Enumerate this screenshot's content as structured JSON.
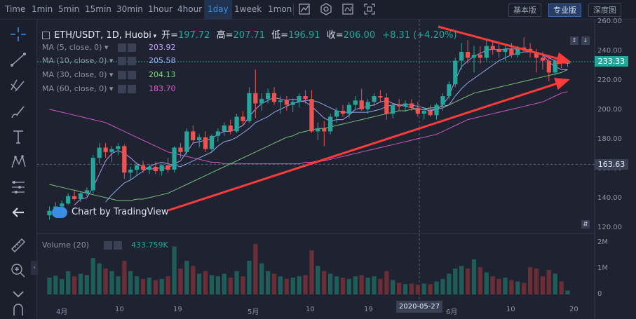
{
  "toolbar": {
    "timeframes": [
      "Time",
      "1min",
      "5min",
      "15min",
      "30min",
      "1hour",
      "4hour",
      "1day",
      "1week",
      "1mon"
    ],
    "active_timeframe": "1day",
    "modes": [
      "基本版",
      "专业版",
      "深度图"
    ],
    "active_mode": "专业版"
  },
  "legend": {
    "symbol": "ETH/USDT, 1D, Huobi",
    "open_label": "开=",
    "open": "197.72",
    "high_label": "高=",
    "high": "207.71",
    "low_label": "低=",
    "low": "196.91",
    "close_label": "收=",
    "close": "206.00",
    "change": "+8.31 (+4.20%)"
  },
  "ma_lines": [
    {
      "label": "MA (5, close, 0)",
      "value": "203.92",
      "color": "#c8a2ff"
    },
    {
      "label": "MA (10, close, 0)",
      "value": "205.58",
      "color": "#a0b4ff"
    },
    {
      "label": "MA (30, close, 0)",
      "value": "204.13",
      "color": "#7fd47f"
    },
    {
      "label": "MA (60, close, 0)",
      "value": "183.70",
      "color": "#e05fd0"
    }
  ],
  "volume_legend": {
    "label": "Volume (20)",
    "value": "433.759K"
  },
  "price_axis": {
    "ticks": [
      "260.00",
      "240.00",
      "220.00",
      "200.00",
      "180.00",
      "160.00",
      "140.00",
      "120.00"
    ]
  },
  "volume_axis": {
    "ticks": [
      "2M",
      "1M",
      "0"
    ]
  },
  "time_axis": {
    "ticks": [
      "4月",
      "10",
      "19",
      "5月",
      "10",
      "19",
      "6月",
      "10",
      "20"
    ],
    "crosshair_date": "2020-05-27"
  },
  "current_price": "233.33",
  "crosshair_price": "163.63",
  "watermark": "Chart by TradingView",
  "colors": {
    "up": "#26a69a",
    "down": "#ef5350",
    "background": "#1f2331",
    "accent": "#3a8ee6",
    "arrow": "#ff3b3b"
  },
  "chart_data": {
    "type": "candlestick",
    "price_range": [
      120,
      260
    ],
    "volume_range": [
      0,
      2000000
    ],
    "x_axis_ticks": [
      "4月",
      "10",
      "19",
      "5月",
      "10",
      "19",
      "6月",
      "10",
      "20"
    ],
    "candles": [
      {
        "o": 129,
        "h": 135,
        "l": 126,
        "c": 132,
        "v": 650000
      },
      {
        "o": 132,
        "h": 138,
        "l": 128,
        "c": 135,
        "v": 720000
      },
      {
        "o": 135,
        "h": 139,
        "l": 133,
        "c": 137,
        "v": 600000
      },
      {
        "o": 137,
        "h": 144,
        "l": 136,
        "c": 142,
        "v": 900000
      },
      {
        "o": 142,
        "h": 146,
        "l": 139,
        "c": 140,
        "v": 700000
      },
      {
        "o": 140,
        "h": 145,
        "l": 138,
        "c": 144,
        "v": 800000
      },
      {
        "o": 144,
        "h": 148,
        "l": 142,
        "c": 146,
        "v": 750000
      },
      {
        "o": 146,
        "h": 170,
        "l": 144,
        "c": 168,
        "v": 1400000
      },
      {
        "o": 168,
        "h": 178,
        "l": 164,
        "c": 175,
        "v": 1200000
      },
      {
        "o": 175,
        "h": 178,
        "l": 168,
        "c": 172,
        "v": 1000000
      },
      {
        "o": 172,
        "h": 176,
        "l": 165,
        "c": 174,
        "v": 900000
      },
      {
        "o": 174,
        "h": 178,
        "l": 170,
        "c": 176,
        "v": 700000
      },
      {
        "o": 176,
        "h": 177,
        "l": 154,
        "c": 158,
        "v": 1300000
      },
      {
        "o": 158,
        "h": 162,
        "l": 153,
        "c": 160,
        "v": 900000
      },
      {
        "o": 160,
        "h": 165,
        "l": 156,
        "c": 163,
        "v": 700000
      },
      {
        "o": 163,
        "h": 166,
        "l": 158,
        "c": 160,
        "v": 600000
      },
      {
        "o": 160,
        "h": 164,
        "l": 157,
        "c": 162,
        "v": 650000
      },
      {
        "o": 162,
        "h": 165,
        "l": 157,
        "c": 159,
        "v": 550000
      },
      {
        "o": 159,
        "h": 164,
        "l": 156,
        "c": 163,
        "v": 600000
      },
      {
        "o": 163,
        "h": 168,
        "l": 158,
        "c": 160,
        "v": 700000
      },
      {
        "o": 160,
        "h": 176,
        "l": 158,
        "c": 175,
        "v": 1850000
      },
      {
        "o": 175,
        "h": 178,
        "l": 168,
        "c": 172,
        "v": 1000000
      },
      {
        "o": 172,
        "h": 188,
        "l": 170,
        "c": 186,
        "v": 1300000
      },
      {
        "o": 186,
        "h": 190,
        "l": 178,
        "c": 180,
        "v": 1100000
      },
      {
        "o": 180,
        "h": 184,
        "l": 175,
        "c": 182,
        "v": 800000
      },
      {
        "o": 182,
        "h": 186,
        "l": 172,
        "c": 174,
        "v": 900000
      },
      {
        "o": 174,
        "h": 184,
        "l": 172,
        "c": 183,
        "v": 750000
      },
      {
        "o": 183,
        "h": 188,
        "l": 179,
        "c": 186,
        "v": 700000
      },
      {
        "o": 186,
        "h": 192,
        "l": 183,
        "c": 190,
        "v": 800000
      },
      {
        "o": 190,
        "h": 194,
        "l": 184,
        "c": 186,
        "v": 650000
      },
      {
        "o": 186,
        "h": 198,
        "l": 185,
        "c": 196,
        "v": 900000
      },
      {
        "o": 196,
        "h": 200,
        "l": 190,
        "c": 193,
        "v": 700000
      },
      {
        "o": 193,
        "h": 216,
        "l": 192,
        "c": 212,
        "v": 1300000
      },
      {
        "o": 212,
        "h": 228,
        "l": 195,
        "c": 205,
        "v": 1950000
      },
      {
        "o": 205,
        "h": 212,
        "l": 200,
        "c": 208,
        "v": 1200000
      },
      {
        "o": 208,
        "h": 215,
        "l": 205,
        "c": 212,
        "v": 900000
      },
      {
        "o": 212,
        "h": 216,
        "l": 204,
        "c": 206,
        "v": 800000
      },
      {
        "o": 206,
        "h": 210,
        "l": 198,
        "c": 207,
        "v": 700000
      },
      {
        "o": 207,
        "h": 210,
        "l": 200,
        "c": 204,
        "v": 600000
      },
      {
        "o": 204,
        "h": 208,
        "l": 199,
        "c": 206,
        "v": 650000
      },
      {
        "o": 206,
        "h": 212,
        "l": 202,
        "c": 210,
        "v": 700000
      },
      {
        "o": 210,
        "h": 214,
        "l": 205,
        "c": 208,
        "v": 750000
      },
      {
        "o": 208,
        "h": 214,
        "l": 185,
        "c": 186,
        "v": 1700000
      },
      {
        "o": 186,
        "h": 192,
        "l": 180,
        "c": 188,
        "v": 1100000
      },
      {
        "o": 188,
        "h": 193,
        "l": 176,
        "c": 186,
        "v": 900000
      },
      {
        "o": 186,
        "h": 198,
        "l": 184,
        "c": 196,
        "v": 800000
      },
      {
        "o": 196,
        "h": 202,
        "l": 192,
        "c": 200,
        "v": 700000
      },
      {
        "o": 200,
        "h": 204,
        "l": 196,
        "c": 198,
        "v": 650000
      },
      {
        "o": 198,
        "h": 206,
        "l": 195,
        "c": 204,
        "v": 600000
      },
      {
        "o": 204,
        "h": 210,
        "l": 201,
        "c": 207,
        "v": 700000
      },
      {
        "o": 207,
        "h": 215,
        "l": 200,
        "c": 201,
        "v": 750000
      },
      {
        "o": 201,
        "h": 208,
        "l": 198,
        "c": 206,
        "v": 650000
      },
      {
        "o": 206,
        "h": 212,
        "l": 203,
        "c": 210,
        "v": 700000
      },
      {
        "o": 210,
        "h": 214,
        "l": 206,
        "c": 209,
        "v": 600000
      },
      {
        "o": 209,
        "h": 212,
        "l": 194,
        "c": 198,
        "v": 900000
      },
      {
        "o": 198,
        "h": 205,
        "l": 195,
        "c": 204,
        "v": 550000
      },
      {
        "o": 204,
        "h": 208,
        "l": 200,
        "c": 203,
        "v": 450000
      },
      {
        "o": 203,
        "h": 207,
        "l": 199,
        "c": 205,
        "v": 400000
      },
      {
        "o": 205,
        "h": 208,
        "l": 200,
        "c": 202,
        "v": 420000
      },
      {
        "o": 202,
        "h": 206,
        "l": 196,
        "c": 198,
        "v": 380000
      },
      {
        "o": 198,
        "h": 202,
        "l": 194,
        "c": 200,
        "v": 420000
      },
      {
        "o": 200,
        "h": 204,
        "l": 196,
        "c": 197,
        "v": 400000
      },
      {
        "o": 197,
        "h": 205,
        "l": 194,
        "c": 204,
        "v": 500000
      },
      {
        "o": 204,
        "h": 212,
        "l": 200,
        "c": 210,
        "v": 600000
      },
      {
        "o": 210,
        "h": 220,
        "l": 208,
        "c": 218,
        "v": 800000
      },
      {
        "o": 218,
        "h": 236,
        "l": 216,
        "c": 234,
        "v": 1000000
      },
      {
        "o": 234,
        "h": 246,
        "l": 228,
        "c": 240,
        "v": 1100000
      },
      {
        "o": 240,
        "h": 248,
        "l": 232,
        "c": 236,
        "v": 1000000
      },
      {
        "o": 236,
        "h": 244,
        "l": 226,
        "c": 238,
        "v": 1350000
      },
      {
        "o": 238,
        "h": 244,
        "l": 232,
        "c": 236,
        "v": 1050000
      },
      {
        "o": 236,
        "h": 248,
        "l": 234,
        "c": 244,
        "v": 850000
      },
      {
        "o": 244,
        "h": 248,
        "l": 238,
        "c": 242,
        "v": 700000
      },
      {
        "o": 242,
        "h": 246,
        "l": 236,
        "c": 240,
        "v": 600000
      },
      {
        "o": 240,
        "h": 244,
        "l": 234,
        "c": 242,
        "v": 650000
      },
      {
        "o": 242,
        "h": 246,
        "l": 236,
        "c": 238,
        "v": 550000
      },
      {
        "o": 238,
        "h": 244,
        "l": 236,
        "c": 243,
        "v": 500000
      },
      {
        "o": 243,
        "h": 250,
        "l": 240,
        "c": 242,
        "v": 450000
      },
      {
        "o": 242,
        "h": 246,
        "l": 236,
        "c": 240,
        "v": 1050000
      },
      {
        "o": 240,
        "h": 242,
        "l": 226,
        "c": 236,
        "v": 1000000
      },
      {
        "o": 236,
        "h": 240,
        "l": 228,
        "c": 234,
        "v": 700000
      },
      {
        "o": 234,
        "h": 238,
        "l": 220,
        "c": 226,
        "v": 950000
      },
      {
        "o": 226,
        "h": 236,
        "l": 224,
        "c": 234,
        "v": 800000
      },
      {
        "o": 234,
        "h": 236,
        "l": 229,
        "c": 232,
        "v": 500000
      },
      {
        "o": 232,
        "h": 235,
        "l": 230,
        "c": 233.33,
        "v": 150000
      }
    ],
    "ma5": [
      null,
      null,
      null,
      null,
      136,
      140,
      141,
      148,
      157,
      166,
      171,
      173,
      171,
      168,
      164,
      162,
      160,
      161,
      161,
      161,
      164,
      166,
      172,
      178,
      179,
      180,
      181,
      184,
      186,
      186,
      188,
      190,
      196,
      201,
      205,
      207,
      209,
      208,
      207,
      208,
      207,
      206,
      203,
      199,
      195,
      193,
      194,
      194,
      197,
      201,
      202,
      203,
      204,
      206,
      207,
      205,
      204,
      203,
      202,
      201,
      201,
      200,
      201,
      204,
      210,
      221,
      230,
      234,
      237,
      239,
      241,
      242,
      241,
      242,
      242,
      242,
      242,
      241,
      239,
      238,
      233,
      230,
      228,
      228
    ],
    "ma10": [
      null,
      null,
      null,
      null,
      null,
      null,
      null,
      null,
      null,
      138,
      143,
      147,
      151,
      153,
      156,
      159,
      162,
      164,
      165,
      164,
      163,
      162,
      164,
      166,
      168,
      170,
      172,
      176,
      179,
      180,
      182,
      185,
      188,
      192,
      194,
      196,
      199,
      201,
      203,
      205,
      206,
      207,
      207,
      206,
      204,
      202,
      200,
      199,
      199,
      199,
      199,
      199,
      200,
      201,
      203,
      204,
      204,
      204,
      204,
      203,
      202,
      201,
      201,
      202,
      204,
      210,
      215,
      219,
      222,
      225,
      228,
      231,
      234,
      236,
      238,
      239,
      240,
      240,
      239,
      238,
      236,
      234,
      233,
      232
    ],
    "ma30": [
      150,
      149,
      148,
      147,
      146,
      145,
      144,
      143,
      142,
      141,
      140,
      139,
      139,
      139,
      140,
      140,
      141,
      142,
      143,
      144,
      146,
      148,
      150,
      152,
      154,
      156,
      158,
      160,
      162,
      164,
      166,
      168,
      170,
      172,
      174,
      176,
      178,
      180,
      182,
      183,
      185,
      186,
      187,
      188,
      188,
      189,
      190,
      191,
      192,
      193,
      194,
      195,
      196,
      197,
      198,
      199,
      200,
      200,
      201,
      201,
      201,
      202,
      202,
      203,
      204,
      206,
      208,
      210,
      212,
      213,
      214,
      215,
      216,
      217,
      218,
      219,
      220,
      221,
      222,
      223,
      224,
      225,
      226,
      228
    ],
    "ma60": [
      201,
      200,
      199,
      198,
      197,
      196,
      195,
      194,
      193,
      192,
      190,
      188,
      186,
      184,
      182,
      180,
      178,
      176,
      174,
      172,
      171,
      170,
      169,
      168,
      167,
      166,
      165,
      165,
      164,
      164,
      164,
      164,
      164,
      164,
      164,
      164,
      164,
      164,
      164,
      164,
      164,
      165,
      165,
      166,
      166,
      167,
      168,
      169,
      170,
      171,
      172,
      173,
      174,
      175,
      176,
      177,
      178,
      179,
      180,
      181,
      182,
      183,
      184,
      186,
      188,
      190,
      192,
      194,
      195,
      196,
      197,
      198,
      199,
      200,
      201,
      202,
      203,
      204,
      205,
      206,
      208,
      210,
      212,
      213
    ]
  }
}
